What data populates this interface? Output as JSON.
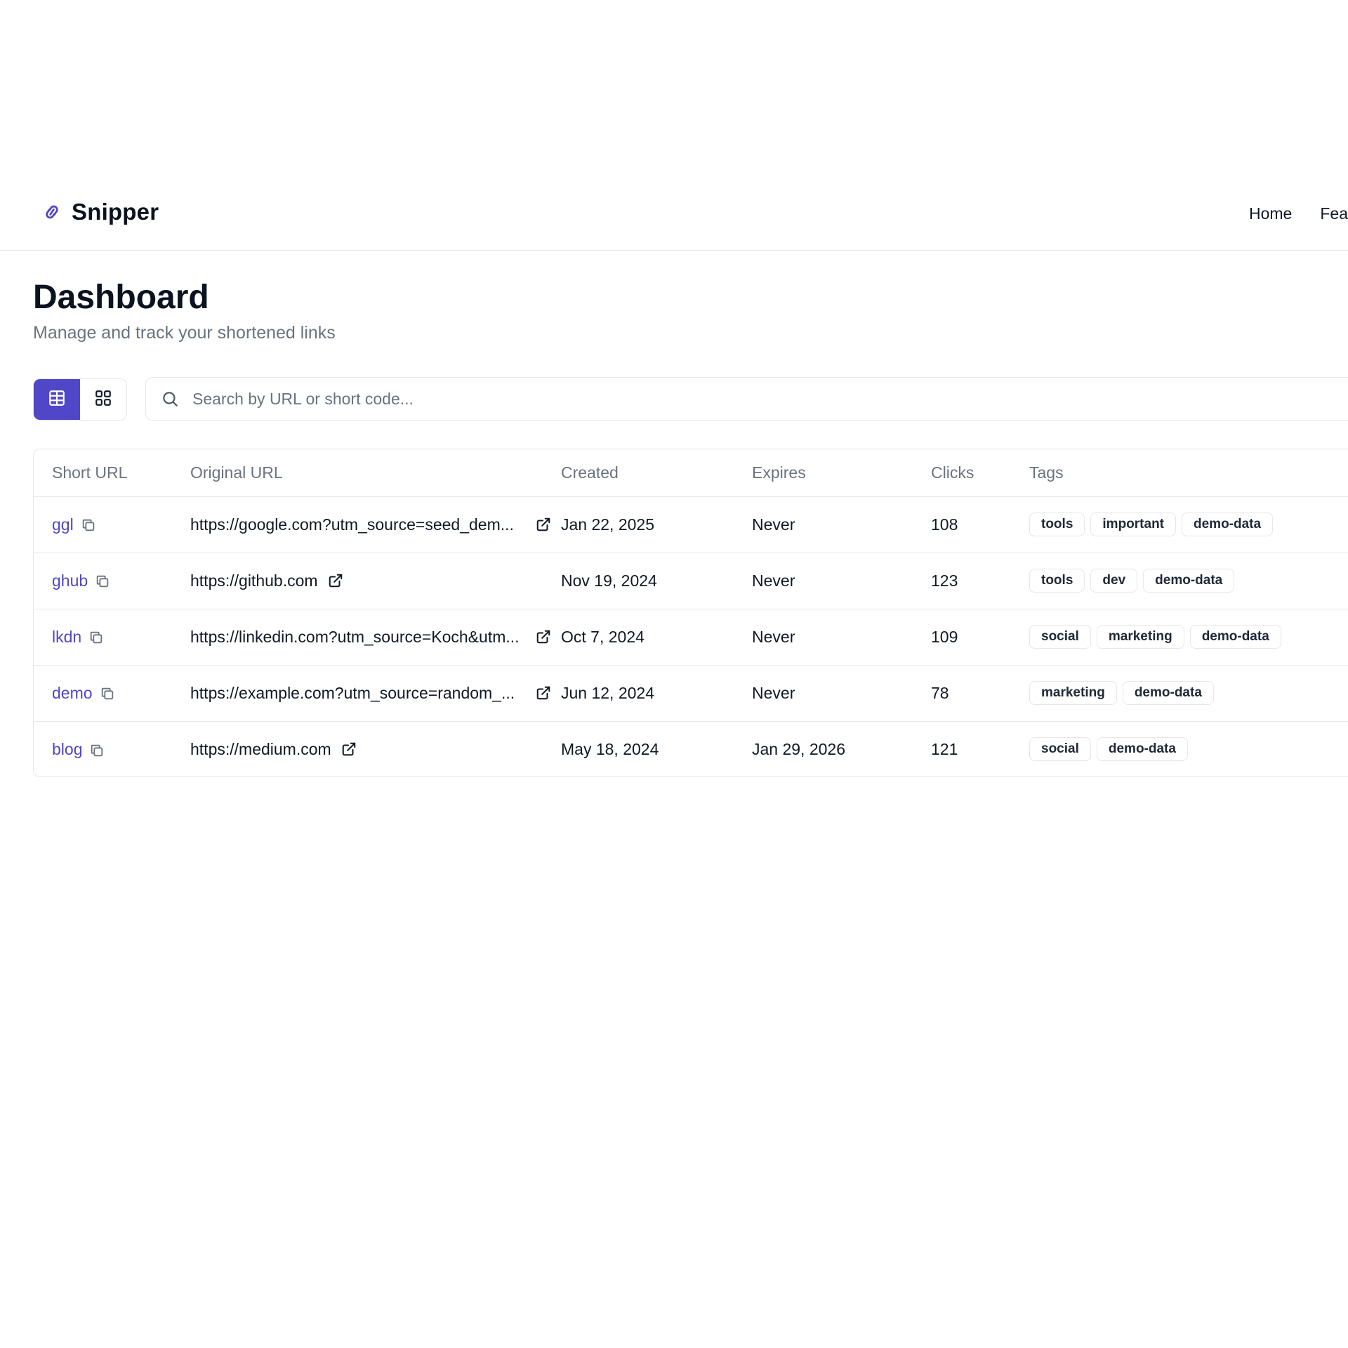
{
  "brand": {
    "name": "Snipper",
    "accent": "#4f46c8"
  },
  "nav": {
    "home": "Home",
    "features": "Feat"
  },
  "page": {
    "title": "Dashboard",
    "subtitle": "Manage and track your shortened links"
  },
  "toolbar": {
    "views": [
      {
        "icon": "table-view-icon",
        "active": true
      },
      {
        "icon": "grid-view-icon",
        "active": false
      }
    ],
    "search_placeholder": "Search by URL or short code..."
  },
  "table": {
    "columns": [
      "Short URL",
      "Original URL",
      "Created",
      "Expires",
      "Clicks",
      "Tags"
    ],
    "rows": [
      {
        "short": "ggl",
        "original": "https://google.com?utm_source=seed_dem...",
        "created": "Jan 22, 2025",
        "expires": "Never",
        "clicks": "108",
        "tags": [
          "tools",
          "important",
          "demo-data"
        ]
      },
      {
        "short": "ghub",
        "original": "https://github.com",
        "created": "Nov 19, 2024",
        "expires": "Never",
        "clicks": "123",
        "tags": [
          "tools",
          "dev",
          "demo-data"
        ]
      },
      {
        "short": "lkdn",
        "original": "https://linkedin.com?utm_source=Koch&utm...",
        "created": "Oct 7, 2024",
        "expires": "Never",
        "clicks": "109",
        "tags": [
          "social",
          "marketing",
          "demo-data"
        ]
      },
      {
        "short": "demo",
        "original": "https://example.com?utm_source=random_...",
        "created": "Jun 12, 2024",
        "expires": "Never",
        "clicks": "78",
        "tags": [
          "marketing",
          "demo-data"
        ]
      },
      {
        "short": "blog",
        "original": "https://medium.com",
        "created": "May 18, 2024",
        "expires": "Jan 29, 2026",
        "clicks": "121",
        "tags": [
          "social",
          "demo-data"
        ]
      }
    ]
  }
}
